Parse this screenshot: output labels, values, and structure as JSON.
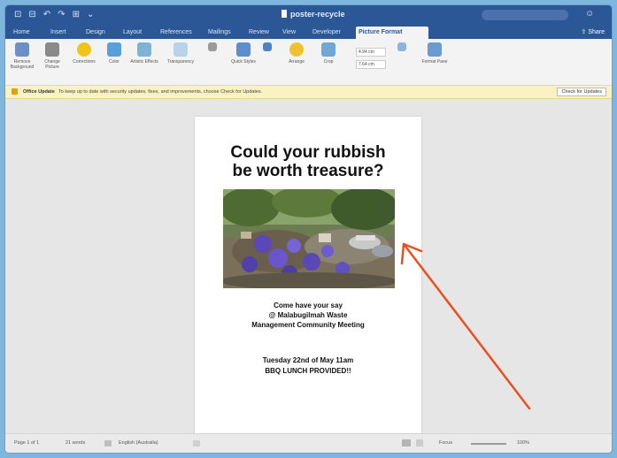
{
  "window": {
    "title": "poster-recycle",
    "quick_access": [
      "⊡",
      "⊟",
      "↶",
      "↷",
      "⊞",
      "⌄"
    ]
  },
  "tabs": {
    "items": [
      "Home",
      "Insert",
      "Design",
      "Layout",
      "References",
      "Mailings",
      "Review",
      "View",
      "Developer",
      "Picture Format"
    ],
    "active": "Picture Format",
    "share_label": "Share"
  },
  "ribbon": {
    "buttons": [
      {
        "label": "Remove Background",
        "icon": "remove-background-icon",
        "color": "#6b8fc7"
      },
      {
        "label": "Change Picture",
        "icon": "change-picture-icon",
        "color": "#8a8a8a"
      },
      {
        "label": "Corrections",
        "icon": "corrections-icon",
        "color": "#f0c419"
      },
      {
        "label": "Color",
        "icon": "color-icon",
        "color": "#5aa0d8"
      },
      {
        "label": "Artistic Effects",
        "icon": "artistic-effects-icon",
        "color": "#7fb3d5"
      },
      {
        "label": "Transparency",
        "icon": "transparency-icon",
        "color": "#b7d3ea"
      },
      {
        "label": "",
        "icon": "compress-icon",
        "color": "#9a9a9a"
      },
      {
        "label": "Quick Styles",
        "icon": "quick-styles-icon",
        "color": "#5c8fc9"
      },
      {
        "label": "",
        "icon": "picture-border-icon",
        "color": "#4c84c4"
      },
      {
        "label": "Arrange",
        "icon": "arrange-icon",
        "color": "#f2c12e"
      },
      {
        "label": "Crop",
        "icon": "crop-icon",
        "color": "#70a7d6"
      },
      {
        "label": "",
        "icon": "align-icon",
        "color": "#8fb5da"
      },
      {
        "label": "Format Pane",
        "icon": "format-pane-icon",
        "color": "#6a9bd0"
      }
    ],
    "height_value": "4.94 cm",
    "width_value": "7.64 cm"
  },
  "update_bar": {
    "title": "Office Update",
    "message": "To keep up to date with security updates, fixes, and improvements, choose Check for Updates.",
    "button": "Check for Updates"
  },
  "poster": {
    "headline_line1": "Could your rubbish",
    "headline_line2": "be worth treasure?",
    "body_line1": "Come have your say",
    "body_line2": "@ Malabugilmah Waste",
    "body_line3": "Management Community Meeting",
    "event_line1": "Tuesday 22nd of May 11am",
    "event_line2": "BBQ LUNCH PROVIDED!!"
  },
  "status_bar": {
    "page": "Page 1 of 1",
    "words": "21 words",
    "language": "English (Australia)",
    "focus": "Focus",
    "zoom": "100%"
  },
  "colors": {
    "brand": "#2b5797",
    "arrow": "#e8501f",
    "update_bg": "#fbf2c4"
  }
}
